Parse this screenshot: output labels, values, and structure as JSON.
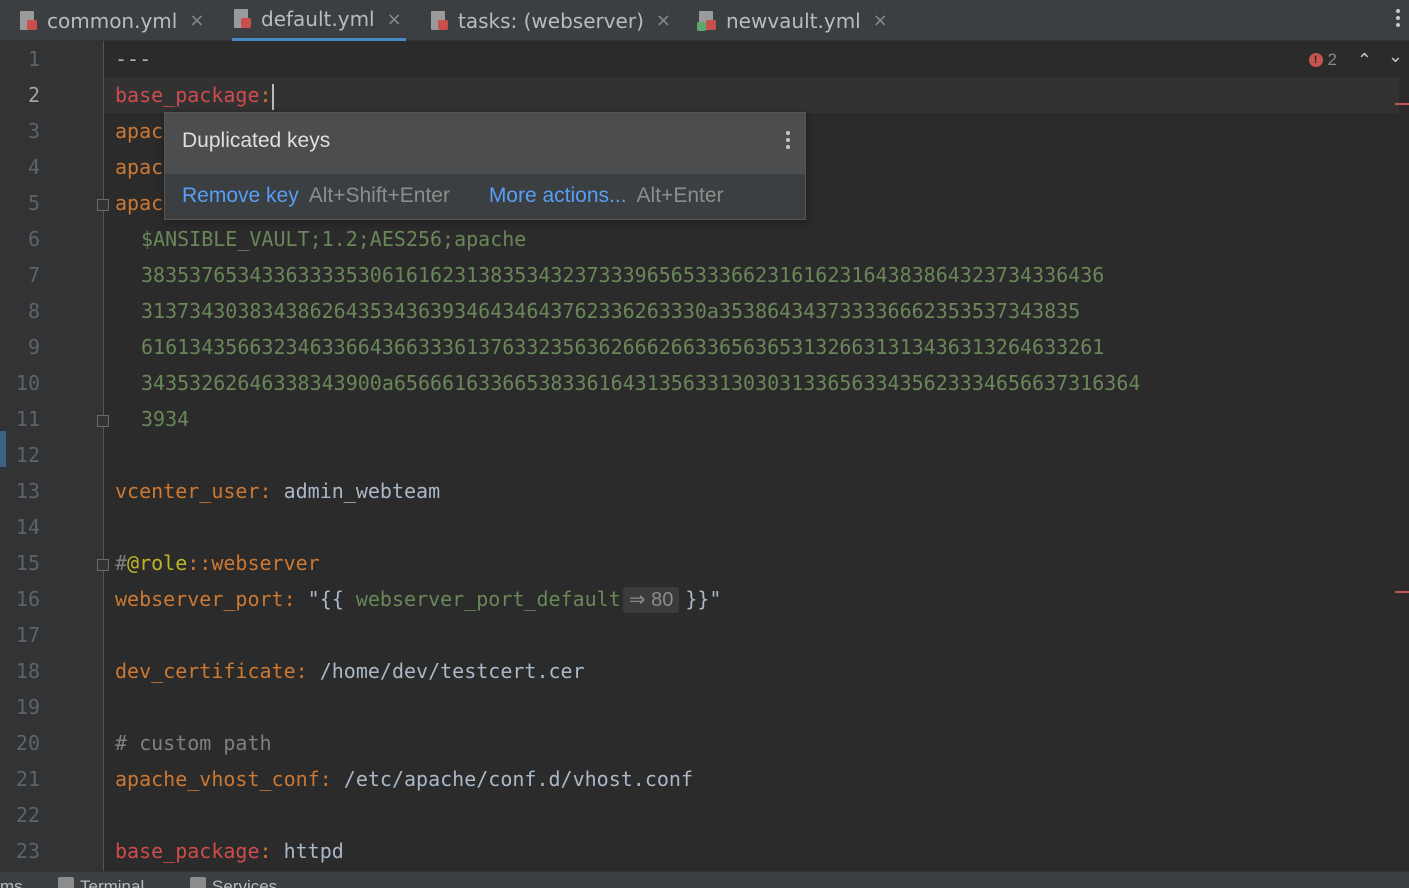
{
  "tabs": [
    {
      "label": "common.yml",
      "active": false,
      "closable": true,
      "icon": "yaml-file-icon"
    },
    {
      "label": "default.yml",
      "active": true,
      "closable": true,
      "icon": "yaml-file-icon"
    },
    {
      "label": "tasks: (webserver)",
      "active": false,
      "closable": true,
      "icon": "ansible-tasks-icon"
    },
    {
      "label": "newvault.yml",
      "active": false,
      "closable": true,
      "icon": "vault-file-icon"
    }
  ],
  "close_glyph": "×",
  "editor": {
    "problem_count": "2",
    "lines": [
      {
        "n": "1",
        "doc_start": "---"
      },
      {
        "n": "2",
        "key": "base_package",
        "colon": ":"
      },
      {
        "n": "3",
        "key_fragment": "apac"
      },
      {
        "n": "4",
        "key_fragment": "apac"
      },
      {
        "n": "5",
        "key_fragment": "apac"
      },
      {
        "n": "6",
        "value": "$ANSIBLE_VAULT;1.2;AES256;apache"
      },
      {
        "n": "7",
        "value": "38353765343363333530616162313835343237333965653336623161623164383864323734336436"
      },
      {
        "n": "8",
        "value": "31373430383438626435343639346434643762336263330a353864343733336662353537343835"
      },
      {
        "n": "9",
        "value": "61613435663234633664366333613763323563626662663365636531326631313436313264633261"
      },
      {
        "n": "10",
        "value": "34353262646338343900a65666163366538336164313563313030313365633435623334656637316364"
      },
      {
        "n": "11",
        "value": "3934"
      },
      {
        "n": "12"
      },
      {
        "n": "13",
        "key": "vcenter_user",
        "colon": ":",
        "value": "admin_webteam"
      },
      {
        "n": "14"
      },
      {
        "n": "15",
        "hash": "#",
        "tag": "@role",
        "rest": "::webserver"
      },
      {
        "n": "16",
        "key": "webserver_port",
        "colon": ":",
        "quote_open": "\"{{",
        "var": "webserver_port_default",
        "hint": "⇒ 80",
        "quote_close": "}}\""
      },
      {
        "n": "17"
      },
      {
        "n": "18",
        "key": "dev_certificate",
        "colon": ":",
        "value": "/home/dev/testcert.cer"
      },
      {
        "n": "19"
      },
      {
        "n": "20",
        "comment": "# custom path"
      },
      {
        "n": "21",
        "key": "apache_vhost_conf",
        "colon": ":",
        "value": "/etc/apache/conf.d/vhost.conf"
      },
      {
        "n": "22"
      },
      {
        "n": "23",
        "key": "base_package",
        "colon": ":",
        "value": "httpd"
      }
    ]
  },
  "popup": {
    "title": "Duplicated keys",
    "action1_label": "Remove key",
    "action1_shortcut": "Alt+Shift+Enter",
    "action2_label": "More actions...",
    "action2_shortcut": "Alt+Enter"
  },
  "bottom_bar": {
    "items": [
      "ms",
      "Terminal",
      "Services"
    ]
  },
  "colors": {
    "key": "#cc7832",
    "duplicate_key": "#cf4c4c",
    "string": "#6a8759",
    "link": "#589df6",
    "tab_underline": "#4a88c7",
    "error": "#c75450"
  }
}
